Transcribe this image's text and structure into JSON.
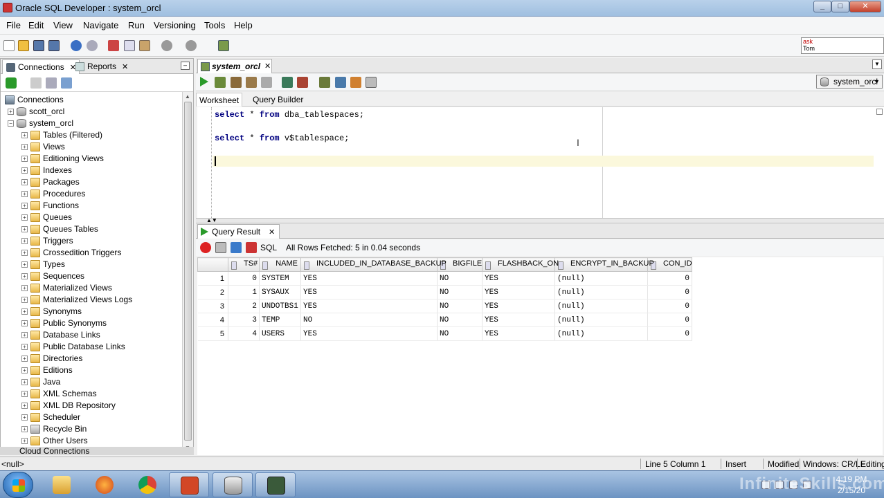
{
  "window": {
    "title": "Oracle SQL Developer : system_orcl",
    "min": "_",
    "max": "□",
    "close": "✕"
  },
  "menu": [
    "File",
    "Edit",
    "View",
    "Navigate",
    "Run",
    "Versioning",
    "Tools",
    "Help"
  ],
  "ask_box": {
    "line1": "ask",
    "line2": "Tom"
  },
  "left_panel": {
    "tabs": [
      {
        "label": "Connections",
        "close": "✕"
      },
      {
        "label": "Reports",
        "close": "✕"
      }
    ],
    "minimize": "–",
    "tree": [
      {
        "label": "Connections",
        "level": 0,
        "expander": "",
        "icon": "connections-icon"
      },
      {
        "label": "scott_orcl",
        "level": 1,
        "expander": "+",
        "icon": "database-icon"
      },
      {
        "label": "system_orcl",
        "level": 1,
        "expander": "−",
        "icon": "database-icon"
      },
      {
        "label": "Tables (Filtered)",
        "level": 2,
        "expander": "+",
        "icon": "folder-icon"
      },
      {
        "label": "Views",
        "level": 2,
        "expander": "+",
        "icon": "folder-icon"
      },
      {
        "label": "Editioning Views",
        "level": 2,
        "expander": "+",
        "icon": "folder-icon"
      },
      {
        "label": "Indexes",
        "level": 2,
        "expander": "+",
        "icon": "folder-icon"
      },
      {
        "label": "Packages",
        "level": 2,
        "expander": "+",
        "icon": "folder-icon"
      },
      {
        "label": "Procedures",
        "level": 2,
        "expander": "+",
        "icon": "folder-icon"
      },
      {
        "label": "Functions",
        "level": 2,
        "expander": "+",
        "icon": "folder-icon"
      },
      {
        "label": "Queues",
        "level": 2,
        "expander": "+",
        "icon": "folder-icon"
      },
      {
        "label": "Queues Tables",
        "level": 2,
        "expander": "+",
        "icon": "folder-icon"
      },
      {
        "label": "Triggers",
        "level": 2,
        "expander": "+",
        "icon": "folder-icon"
      },
      {
        "label": "Crossedition Triggers",
        "level": 2,
        "expander": "+",
        "icon": "folder-icon"
      },
      {
        "label": "Types",
        "level": 2,
        "expander": "+",
        "icon": "folder-icon"
      },
      {
        "label": "Sequences",
        "level": 2,
        "expander": "+",
        "icon": "folder-icon"
      },
      {
        "label": "Materialized Views",
        "level": 2,
        "expander": "+",
        "icon": "folder-icon"
      },
      {
        "label": "Materialized Views Logs",
        "level": 2,
        "expander": "+",
        "icon": "folder-icon"
      },
      {
        "label": "Synonyms",
        "level": 2,
        "expander": "+",
        "icon": "folder-icon"
      },
      {
        "label": "Public Synonyms",
        "level": 2,
        "expander": "+",
        "icon": "folder-icon"
      },
      {
        "label": "Database Links",
        "level": 2,
        "expander": "+",
        "icon": "folder-icon"
      },
      {
        "label": "Public Database Links",
        "level": 2,
        "expander": "+",
        "icon": "folder-icon"
      },
      {
        "label": "Directories",
        "level": 2,
        "expander": "+",
        "icon": "folder-icon"
      },
      {
        "label": "Editions",
        "level": 2,
        "expander": "+",
        "icon": "folder-icon"
      },
      {
        "label": "Java",
        "level": 2,
        "expander": "+",
        "icon": "folder-icon"
      },
      {
        "label": "XML Schemas",
        "level": 2,
        "expander": "+",
        "icon": "folder-icon"
      },
      {
        "label": "XML DB Repository",
        "level": 2,
        "expander": "+",
        "icon": "folder-icon"
      },
      {
        "label": "Scheduler",
        "level": 2,
        "expander": "+",
        "icon": "folder-icon"
      },
      {
        "label": "Recycle Bin",
        "level": 2,
        "expander": "+",
        "icon": "recycle-bin-icon"
      },
      {
        "label": "Other Users",
        "level": 2,
        "expander": "+",
        "icon": "folder-icon"
      }
    ],
    "cloud": "Cloud Connections"
  },
  "editor": {
    "tab": {
      "label": "system_orcl",
      "close": "✕"
    },
    "connection": "system_orcl",
    "subtabs": [
      "Worksheet",
      "Query Builder"
    ],
    "code": [
      {
        "kw1": "select",
        "mid": " * ",
        "kw2": "from",
        "rest": " dba_tablespaces;"
      },
      {
        "kw1": "select",
        "mid": " * ",
        "kw2": "from",
        "rest": " v$tablespace;"
      }
    ]
  },
  "results": {
    "tab": {
      "label": "Query Result",
      "close": "✕"
    },
    "sql_label": "SQL",
    "status": "All Rows Fetched: 5 in 0.04 seconds",
    "columns": [
      "",
      "TS#",
      "NAME",
      "INCLUDED_IN_DATABASE_BACKUP",
      "BIGFILE",
      "FLASHBACK_ON",
      "ENCRYPT_IN_BACKUP",
      "CON_ID"
    ],
    "rows": [
      [
        "1",
        "0",
        "SYSTEM",
        "YES",
        "NO",
        "YES",
        "(null)",
        "0"
      ],
      [
        "2",
        "1",
        "SYSAUX",
        "YES",
        "NO",
        "YES",
        "(null)",
        "0"
      ],
      [
        "3",
        "2",
        "UNDOTBS1",
        "YES",
        "NO",
        "YES",
        "(null)",
        "0"
      ],
      [
        "4",
        "3",
        "TEMP",
        "NO",
        "NO",
        "YES",
        "(null)",
        "0"
      ],
      [
        "5",
        "4",
        "USERS",
        "YES",
        "NO",
        "YES",
        "(null)",
        "0"
      ]
    ]
  },
  "statusbar": {
    "left": "<null>",
    "position": "Line 5 Column 1",
    "mode": "Insert",
    "modified": "Modified",
    "eol": "Windows: CR/LF",
    "editing": "Editing"
  },
  "taskbar": {
    "time": "4:19 PM",
    "date": "2/15/20"
  },
  "watermark": "InfiniteSkills.com"
}
